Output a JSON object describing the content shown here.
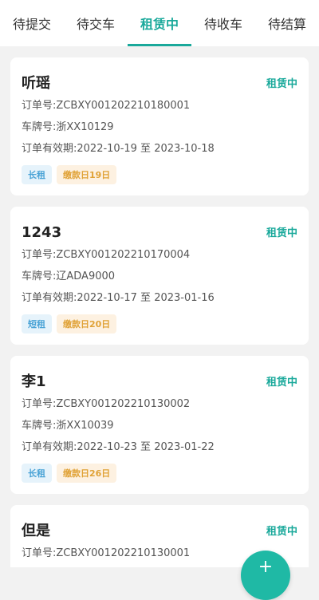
{
  "tabs": [
    {
      "label": "待提交",
      "active": false
    },
    {
      "label": "待交车",
      "active": false
    },
    {
      "label": "租赁中",
      "active": true
    },
    {
      "label": "待收车",
      "active": false
    },
    {
      "label": "待结算",
      "active": false
    }
  ],
  "orders": [
    {
      "name": "听瑶",
      "status": "租赁中",
      "order_no": "订单号:ZCBXY001202210180001",
      "plate": "车牌号:浙XX10129",
      "validity": "订单有效期:2022-10-19 至 2023-10-18",
      "type_badge": "长租",
      "pay_badge": "缴款日19日"
    },
    {
      "name": "1243",
      "status": "租赁中",
      "order_no": "订单号:ZCBXY001202210170004",
      "plate": "车牌号:辽ADA9000",
      "validity": "订单有效期:2022-10-17 至 2023-01-16",
      "type_badge": "短租",
      "pay_badge": "缴款日20日"
    },
    {
      "name": "李1",
      "status": "租赁中",
      "order_no": "订单号:ZCBXY001202210130002",
      "plate": "车牌号:浙XX10039",
      "validity": "订单有效期:2022-10-23 至 2023-01-22",
      "type_badge": "长租",
      "pay_badge": "缴款日26日"
    },
    {
      "name": "但是",
      "status": "租赁中",
      "order_no": "订单号:ZCBXY001202210130001"
    }
  ],
  "colors": {
    "accent": "#1aa99b",
    "type_badge_bg": "#e6f3fb",
    "type_badge_text": "#4aa3d6",
    "pay_badge_bg": "#fdf1e1",
    "pay_badge_text": "#e0a236"
  },
  "fab": {
    "icon": "plus-icon"
  }
}
